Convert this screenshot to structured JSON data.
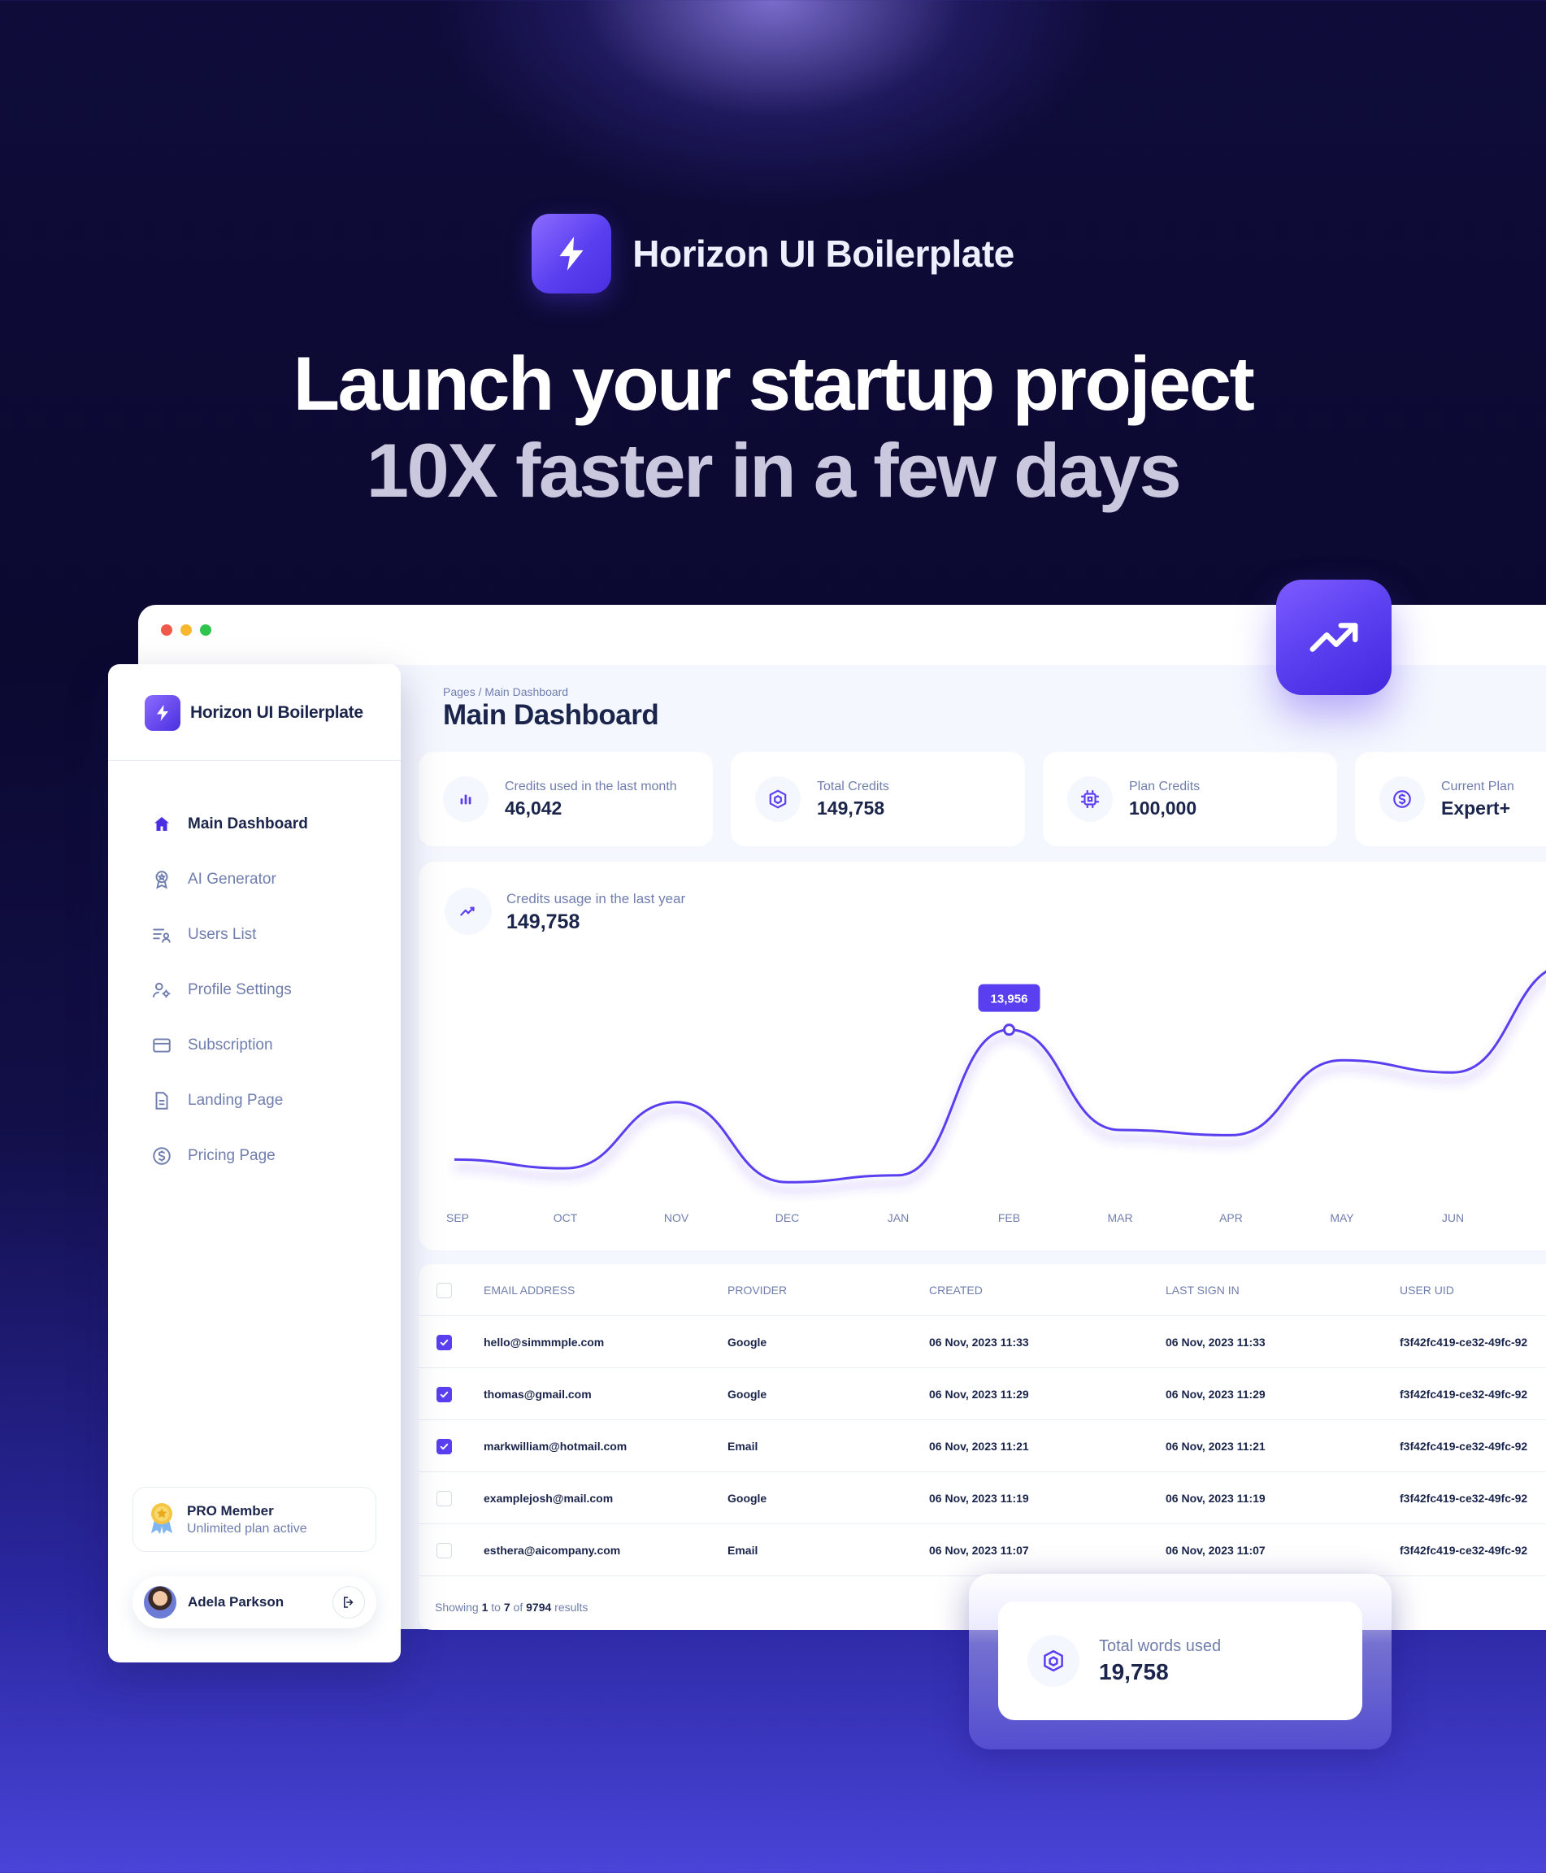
{
  "brand": {
    "title": "Horizon UI Boilerplate"
  },
  "hero": {
    "line1": "Launch your startup project",
    "line2": "10X faster in a few days"
  },
  "sidebar": {
    "brand": "Horizon UI Boilerplate",
    "items": [
      {
        "label": "Main Dashboard",
        "icon": "home-icon",
        "active": true
      },
      {
        "label": "AI Generator",
        "icon": "award-icon"
      },
      {
        "label": "Users List",
        "icon": "list-icon"
      },
      {
        "label": "Profile Settings",
        "icon": "user-gear-icon"
      },
      {
        "label": "Subscription",
        "icon": "card-icon"
      },
      {
        "label": "Landing Page",
        "icon": "document-icon"
      },
      {
        "label": "Pricing Page",
        "icon": "dollar-icon"
      }
    ],
    "pro": {
      "title": "PRO Member",
      "subtitle": "Unlimited plan active"
    },
    "user": {
      "name": "Adela Parkson"
    }
  },
  "header": {
    "breadcrumb": "Pages / Main Dashboard",
    "title": "Main Dashboard"
  },
  "stats": [
    {
      "label": "Credits used in the last month",
      "value": "46,042",
      "icon": "bar-chart-icon"
    },
    {
      "label": "Total Credits",
      "value": "149,758",
      "icon": "cube-icon"
    },
    {
      "label": "Plan Credits",
      "value": "100,000",
      "icon": "chip-icon"
    },
    {
      "label": "Current Plan",
      "value": "Expert+",
      "icon": "dollar-icon"
    }
  ],
  "chart_card": {
    "label": "Credits usage in the last year",
    "value": "149,758",
    "tooltip": "13,956"
  },
  "chart_data": {
    "type": "line",
    "categories": [
      "SEP",
      "OCT",
      "NOV",
      "DEC",
      "JAN",
      "FEB",
      "MAR",
      "APR",
      "MAY",
      "JUN"
    ],
    "series": [
      {
        "values": [
          6500,
          6000,
          9800,
          5200,
          5600,
          13956,
          8200,
          7900,
          12200,
          11500
        ]
      }
    ],
    "highlight": {
      "category": "FEB",
      "value": 13956
    },
    "ylim": [
      4000,
      18000
    ],
    "grid": false,
    "colors": {
      "line": "#5a3ff0"
    }
  },
  "table": {
    "columns": [
      "EMAIL ADDRESS",
      "PROVIDER",
      "CREATED",
      "LAST SIGN IN",
      "USER UID"
    ],
    "rows": [
      {
        "checked": true,
        "email": "hello@simmmple.com",
        "provider": "Google",
        "created": "06 Nov, 2023 11:33",
        "last": "06 Nov, 2023 11:33",
        "uid": "f3f42fc419-ce32-49fc-92"
      },
      {
        "checked": true,
        "email": "thomas@gmail.com",
        "provider": "Google",
        "created": "06 Nov, 2023 11:29",
        "last": "06 Nov, 2023 11:29",
        "uid": "f3f42fc419-ce32-49fc-92"
      },
      {
        "checked": true,
        "email": "markwilliam@hotmail.com",
        "provider": "Email",
        "created": "06 Nov, 2023 11:21",
        "last": "06 Nov, 2023 11:21",
        "uid": "f3f42fc419-ce32-49fc-92"
      },
      {
        "checked": false,
        "email": "examplejosh@mail.com",
        "provider": "Google",
        "created": "06 Nov, 2023 11:19",
        "last": "06 Nov, 2023 11:19",
        "uid": "f3f42fc419-ce32-49fc-92"
      },
      {
        "checked": false,
        "email": "esthera@aicompany.com",
        "provider": "Email",
        "created": "06 Nov, 2023 11:07",
        "last": "06 Nov, 2023 11:07",
        "uid": "f3f42fc419-ce32-49fc-92"
      }
    ],
    "showing": {
      "prefix": "Showing",
      "from": "1",
      "to_word": "to",
      "to": "7",
      "of_word": "of",
      "total": "9794",
      "suffix": "results"
    }
  },
  "words_card": {
    "label": "Total words used",
    "value": "19,758",
    "icon": "cube-icon"
  },
  "colors": {
    "accent": "#5a3ff0",
    "text_dark": "#1b254b",
    "text_muted": "#707eae"
  }
}
